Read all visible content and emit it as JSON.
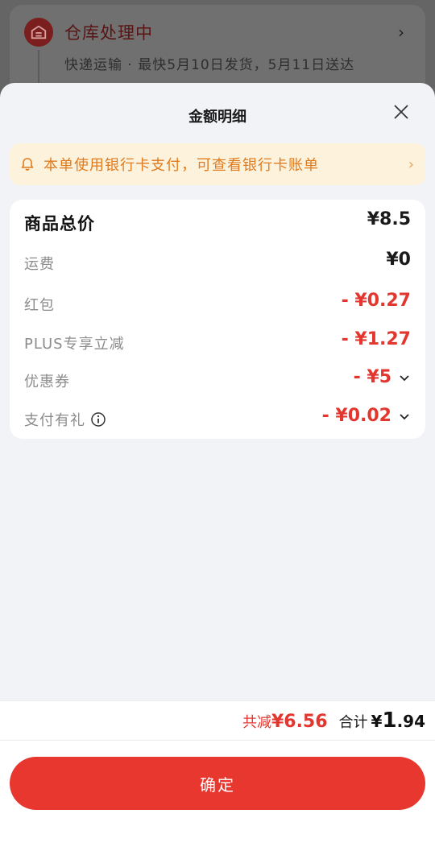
{
  "background_card": {
    "title": "仓库处理中",
    "subtitle": "快递运输 · 最快5月10日发货，5月11日送达",
    "chevron": "›",
    "icon": "warehouse-icon"
  },
  "sheet": {
    "title": "金额明细",
    "close_icon": "close-icon"
  },
  "notice": {
    "text": "本单使用银行卡支付，可查看银行卡账单",
    "icon": "bell-icon",
    "chevron": "›"
  },
  "details": {
    "rows": [
      {
        "label": "商品总价",
        "value": "¥8.5"
      },
      {
        "label": "运费",
        "value": "¥0"
      },
      {
        "label": "红包",
        "value": "- ¥0.27"
      },
      {
        "label": "PLUS专享立减",
        "value": "- ¥1.27"
      },
      {
        "label": "优惠券",
        "value": "- ¥5"
      },
      {
        "label": "支付有礼",
        "value": "- ¥0.02"
      }
    ]
  },
  "summary": {
    "saved_label": "共减",
    "saved_value": "¥6.56",
    "total_label": "合计",
    "total_symbol": "¥",
    "total_int": "1",
    "total_dec": ".94"
  },
  "confirm_label": "确定",
  "colors": {
    "accent_red": "#e2362f",
    "notice_orange": "#e07b1f",
    "notice_bg": "#fdf2dc",
    "sheet_bg": "#f2f3f7"
  }
}
